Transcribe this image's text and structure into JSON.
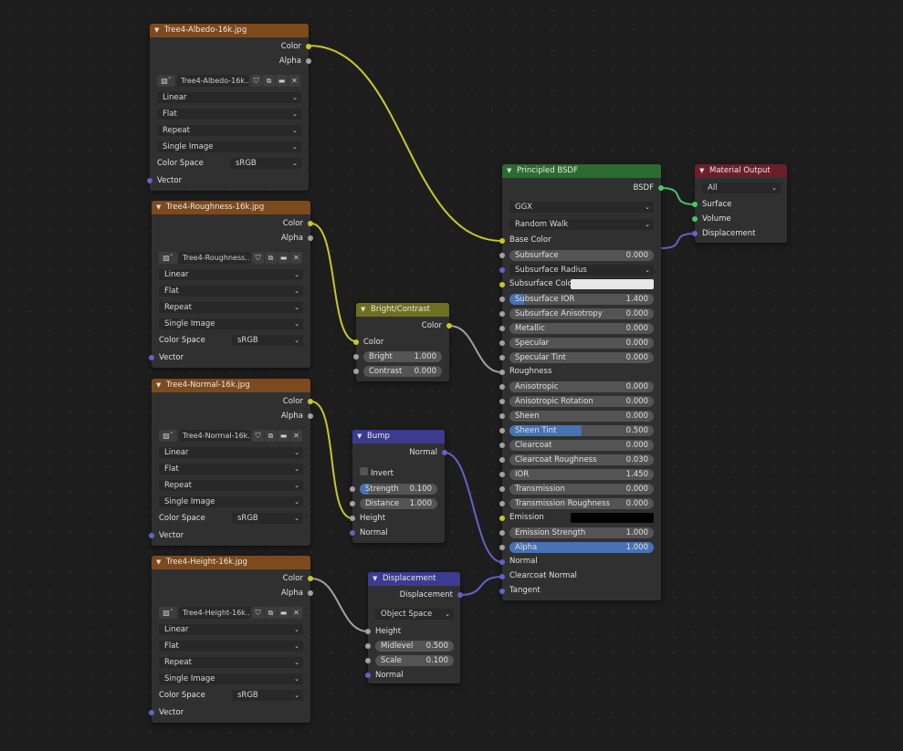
{
  "image_nodes": [
    {
      "title": "Tree4-Albedo-16k.jpg",
      "file": "Tree4-Albedo-16k...",
      "out_color": "Color",
      "out_alpha": "Alpha",
      "interpolation": "Linear",
      "projection": "Flat",
      "extension": "Repeat",
      "source": "Single Image",
      "color_space_label": "Color Space",
      "color_space": "sRGB",
      "in_vector": "Vector"
    },
    {
      "title": "Tree4-Roughness-16k.jpg",
      "file": "Tree4-Roughness...",
      "out_color": "Color",
      "out_alpha": "Alpha",
      "interpolation": "Linear",
      "projection": "Flat",
      "extension": "Repeat",
      "source": "Single Image",
      "color_space_label": "Color Space",
      "color_space": "sRGB",
      "in_vector": "Vector"
    },
    {
      "title": "Tree4-Normal-16k.jpg",
      "file": "Tree4-Normal-16k...",
      "out_color": "Color",
      "out_alpha": "Alpha",
      "interpolation": "Linear",
      "projection": "Flat",
      "extension": "Repeat",
      "source": "Single Image",
      "color_space_label": "Color Space",
      "color_space": "sRGB",
      "in_vector": "Vector"
    },
    {
      "title": "Tree4-Height-16k.jpg",
      "file": "Tree4-Height-16k...",
      "out_color": "Color",
      "out_alpha": "Alpha",
      "interpolation": "Linear",
      "projection": "Flat",
      "extension": "Repeat",
      "source": "Single Image",
      "color_space_label": "Color Space",
      "color_space": "sRGB",
      "in_vector": "Vector"
    }
  ],
  "bright_contrast": {
    "title": "Bright/Contrast",
    "out_color": "Color",
    "in_color": "Color",
    "bright_label": "Bright",
    "bright_value": "1.000",
    "contrast_label": "Contrast",
    "contrast_value": "0.000"
  },
  "bump": {
    "title": "Bump",
    "out_normal": "Normal",
    "invert_label": "Invert",
    "strength_label": "Strength",
    "strength_value": "0.100",
    "strength_fraction": 0.1,
    "distance_label": "Distance",
    "distance_value": "1.000",
    "in_height": "Height",
    "in_normal": "Normal"
  },
  "displacement": {
    "title": "Displacement",
    "out_displacement": "Displacement",
    "space": "Object Space",
    "in_height": "Height",
    "midlevel_label": "Midlevel",
    "midlevel_value": "0.500",
    "scale_label": "Scale",
    "scale_value": "0.100",
    "in_normal": "Normal"
  },
  "principled": {
    "title": "Principled BSDF",
    "out_bsdf": "BSDF",
    "distribution": "GGX",
    "subsurface_method": "Random Walk",
    "inputs": [
      {
        "kind": "socket",
        "label": "Base Color",
        "sock": "sy"
      },
      {
        "kind": "field",
        "label": "Subsurface",
        "value": "0.000",
        "fill": 0,
        "sock": "sg"
      },
      {
        "kind": "dropdown",
        "label": "Subsurface Radius",
        "sock": "sv"
      },
      {
        "kind": "color",
        "label": "Subsurface Colo",
        "swatch": "#e6e6e6",
        "sock": "sy"
      },
      {
        "kind": "field",
        "label": "Subsurface IOR",
        "value": "1.400",
        "fill": 0.1,
        "sock": "sg"
      },
      {
        "kind": "field",
        "label": "Subsurface Anisotropy",
        "value": "0.000",
        "fill": 0,
        "sock": "sg"
      },
      {
        "kind": "field",
        "label": "Metallic",
        "value": "0.000",
        "fill": 0,
        "sock": "sg"
      },
      {
        "kind": "field",
        "label": "Specular",
        "value": "0.000",
        "fill": 0,
        "sock": "sg"
      },
      {
        "kind": "field",
        "label": "Specular Tint",
        "value": "0.000",
        "fill": 0,
        "sock": "sg"
      },
      {
        "kind": "socket",
        "label": "Roughness",
        "sock": "sg"
      },
      {
        "kind": "field",
        "label": "Anisotropic",
        "value": "0.000",
        "fill": 0,
        "sock": "sg"
      },
      {
        "kind": "field",
        "label": "Anisotropic Rotation",
        "value": "0.000",
        "fill": 0,
        "sock": "sg"
      },
      {
        "kind": "field",
        "label": "Sheen",
        "value": "0.000",
        "fill": 0,
        "sock": "sg"
      },
      {
        "kind": "field",
        "label": "Sheen Tint",
        "value": "0.500",
        "fill": 0.5,
        "sock": "sg"
      },
      {
        "kind": "field",
        "label": "Clearcoat",
        "value": "0.000",
        "fill": 0,
        "sock": "sg"
      },
      {
        "kind": "field",
        "label": "Clearcoat Roughness",
        "value": "0.030",
        "fill": 0,
        "sock": "sg"
      },
      {
        "kind": "field",
        "label": "IOR",
        "value": "1.450",
        "fill": 0,
        "sock": "sg"
      },
      {
        "kind": "field",
        "label": "Transmission",
        "value": "0.000",
        "fill": 0,
        "sock": "sg"
      },
      {
        "kind": "field",
        "label": "Transmission Roughness",
        "value": "0.000",
        "fill": 0,
        "sock": "sg"
      },
      {
        "kind": "color",
        "label": "Emission",
        "swatch": "#000000",
        "sock": "sy"
      },
      {
        "kind": "field",
        "label": "Emission Strength",
        "value": "1.000",
        "fill": 0,
        "sock": "sg"
      },
      {
        "kind": "field",
        "label": "Alpha",
        "value": "1.000",
        "fill": 1,
        "sock": "sg"
      },
      {
        "kind": "socket",
        "label": "Normal",
        "sock": "sv"
      },
      {
        "kind": "socket",
        "label": "Clearcoat Normal",
        "sock": "sv"
      },
      {
        "kind": "socket",
        "label": "Tangent",
        "sock": "sv"
      }
    ]
  },
  "material_output": {
    "title": "Material Output",
    "target": "All",
    "in_surface": "Surface",
    "in_volume": "Volume",
    "in_displacement": "Displacement"
  },
  "colors": {
    "image_header": "#7c4a1c",
    "converter_header": "#6f6f1f",
    "vector_header": "#3b3b8f",
    "shader_header": "#2c6b30",
    "output_header": "#6b1e2a",
    "socket_color": "#c7c729",
    "socket_float": "#a1a1a1",
    "socket_vector": "#6363c7",
    "socket_shader": "#4cc46a"
  }
}
